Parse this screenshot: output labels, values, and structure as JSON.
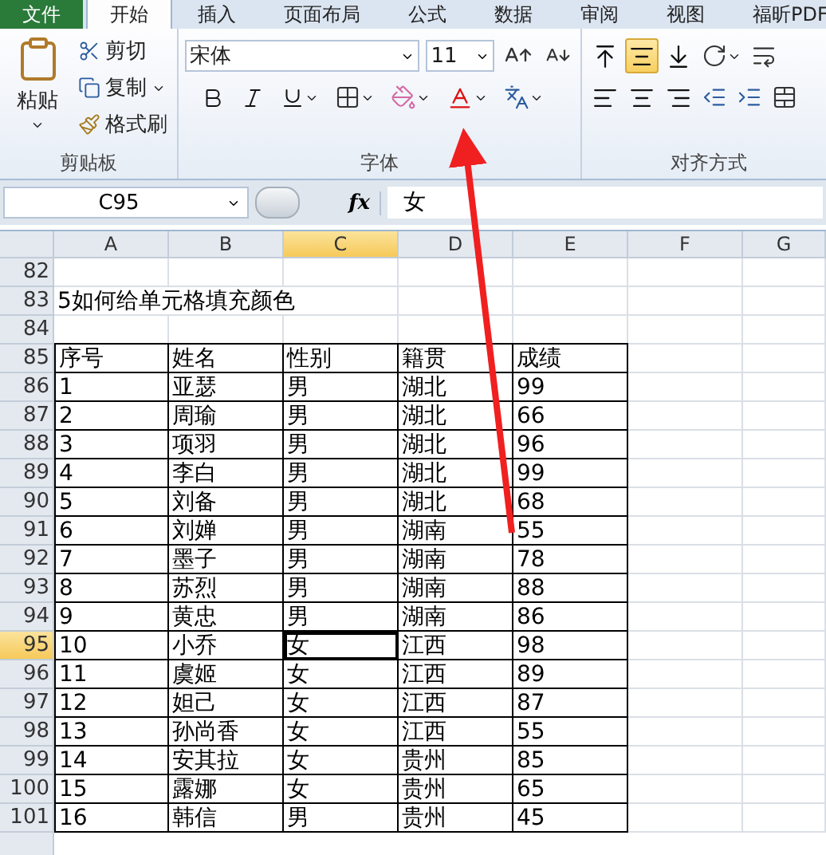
{
  "tabs": [
    {
      "label": "文件",
      "kind": "file",
      "selected": false
    },
    {
      "label": "开始",
      "kind": "tab",
      "selected": true
    },
    {
      "label": "插入",
      "kind": "tab",
      "selected": false
    },
    {
      "label": "页面布局",
      "kind": "tab",
      "selected": false
    },
    {
      "label": "公式",
      "kind": "tab",
      "selected": false
    },
    {
      "label": "数据",
      "kind": "tab",
      "selected": false
    },
    {
      "label": "审阅",
      "kind": "tab",
      "selected": false
    },
    {
      "label": "视图",
      "kind": "tab",
      "selected": false
    },
    {
      "label": "福昕PDF",
      "kind": "tab",
      "selected": false
    }
  ],
  "clipboard": {
    "paste": "粘贴",
    "cut": "剪切",
    "copy": "复制",
    "format_painter": "格式刷",
    "label": "剪贴板"
  },
  "font": {
    "name": "宋体",
    "size": "11",
    "label": "字体"
  },
  "alignment": {
    "label": "对齐方式",
    "vertical": [
      {
        "kind": "top",
        "selected": false
      },
      {
        "kind": "middle",
        "selected": true
      },
      {
        "kind": "bottom",
        "selected": false
      }
    ]
  },
  "formula_bar": {
    "name_box": "C95",
    "fx": "fx",
    "value": "女"
  },
  "columns": [
    {
      "label": "A",
      "selected": false
    },
    {
      "label": "B",
      "selected": false
    },
    {
      "label": "C",
      "selected": true
    },
    {
      "label": "D",
      "selected": false
    },
    {
      "label": "E",
      "selected": false
    },
    {
      "label": "F",
      "selected": false
    },
    {
      "label": "G",
      "selected": false
    }
  ],
  "rows": [
    {
      "number": "82",
      "selected": false,
      "bordered": false
    },
    {
      "number": "83",
      "selected": false,
      "bordered": false,
      "title": "5如何给单元格填充颜色"
    },
    {
      "number": "84",
      "selected": false,
      "bordered": false
    },
    {
      "number": "85",
      "selected": false,
      "bordered": true,
      "cells": [
        "序号",
        "姓名",
        "性别",
        "籍贯",
        "成绩"
      ]
    },
    {
      "number": "86",
      "selected": false,
      "bordered": true,
      "cells": [
        "1",
        "亚瑟",
        "男",
        "湖北",
        "99"
      ]
    },
    {
      "number": "87",
      "selected": false,
      "bordered": true,
      "cells": [
        "2",
        "周瑜",
        "男",
        "湖北",
        "66"
      ]
    },
    {
      "number": "88",
      "selected": false,
      "bordered": true,
      "cells": [
        "3",
        "项羽",
        "男",
        "湖北",
        "96"
      ]
    },
    {
      "number": "89",
      "selected": false,
      "bordered": true,
      "cells": [
        "4",
        "李白",
        "男",
        "湖北",
        "99"
      ]
    },
    {
      "number": "90",
      "selected": false,
      "bordered": true,
      "cells": [
        "5",
        "刘备",
        "男",
        "湖北",
        "68"
      ]
    },
    {
      "number": "91",
      "selected": false,
      "bordered": true,
      "cells": [
        "6",
        "刘婵",
        "男",
        "湖南",
        "55"
      ]
    },
    {
      "number": "92",
      "selected": false,
      "bordered": true,
      "cells": [
        "7",
        "墨子",
        "男",
        "湖南",
        "78"
      ]
    },
    {
      "number": "93",
      "selected": false,
      "bordered": true,
      "cells": [
        "8",
        "苏烈",
        "男",
        "湖南",
        "88"
      ]
    },
    {
      "number": "94",
      "selected": false,
      "bordered": true,
      "cells": [
        "9",
        "黄忠",
        "男",
        "湖南",
        "86"
      ]
    },
    {
      "number": "95",
      "selected": true,
      "bordered": true,
      "cells": [
        "10",
        "小乔",
        "女",
        "江西",
        "98"
      ]
    },
    {
      "number": "96",
      "selected": false,
      "bordered": true,
      "cells": [
        "11",
        "虞姬",
        "女",
        "江西",
        "89"
      ]
    },
    {
      "number": "97",
      "selected": false,
      "bordered": true,
      "cells": [
        "12",
        "妲己",
        "女",
        "江西",
        "87"
      ]
    },
    {
      "number": "98",
      "selected": false,
      "bordered": true,
      "cells": [
        "13",
        "孙尚香",
        "女",
        "江西",
        "55"
      ]
    },
    {
      "number": "99",
      "selected": false,
      "bordered": true,
      "cells": [
        "14",
        "安其拉",
        "女",
        "贵州",
        "85"
      ]
    },
    {
      "number": "100",
      "selected": false,
      "bordered": true,
      "cells": [
        "15",
        "露娜",
        "女",
        "贵州",
        "65"
      ]
    },
    {
      "number": "101",
      "selected": false,
      "bordered": true,
      "cells": [
        "16",
        "韩信",
        "男",
        "贵州",
        "45"
      ]
    }
  ]
}
